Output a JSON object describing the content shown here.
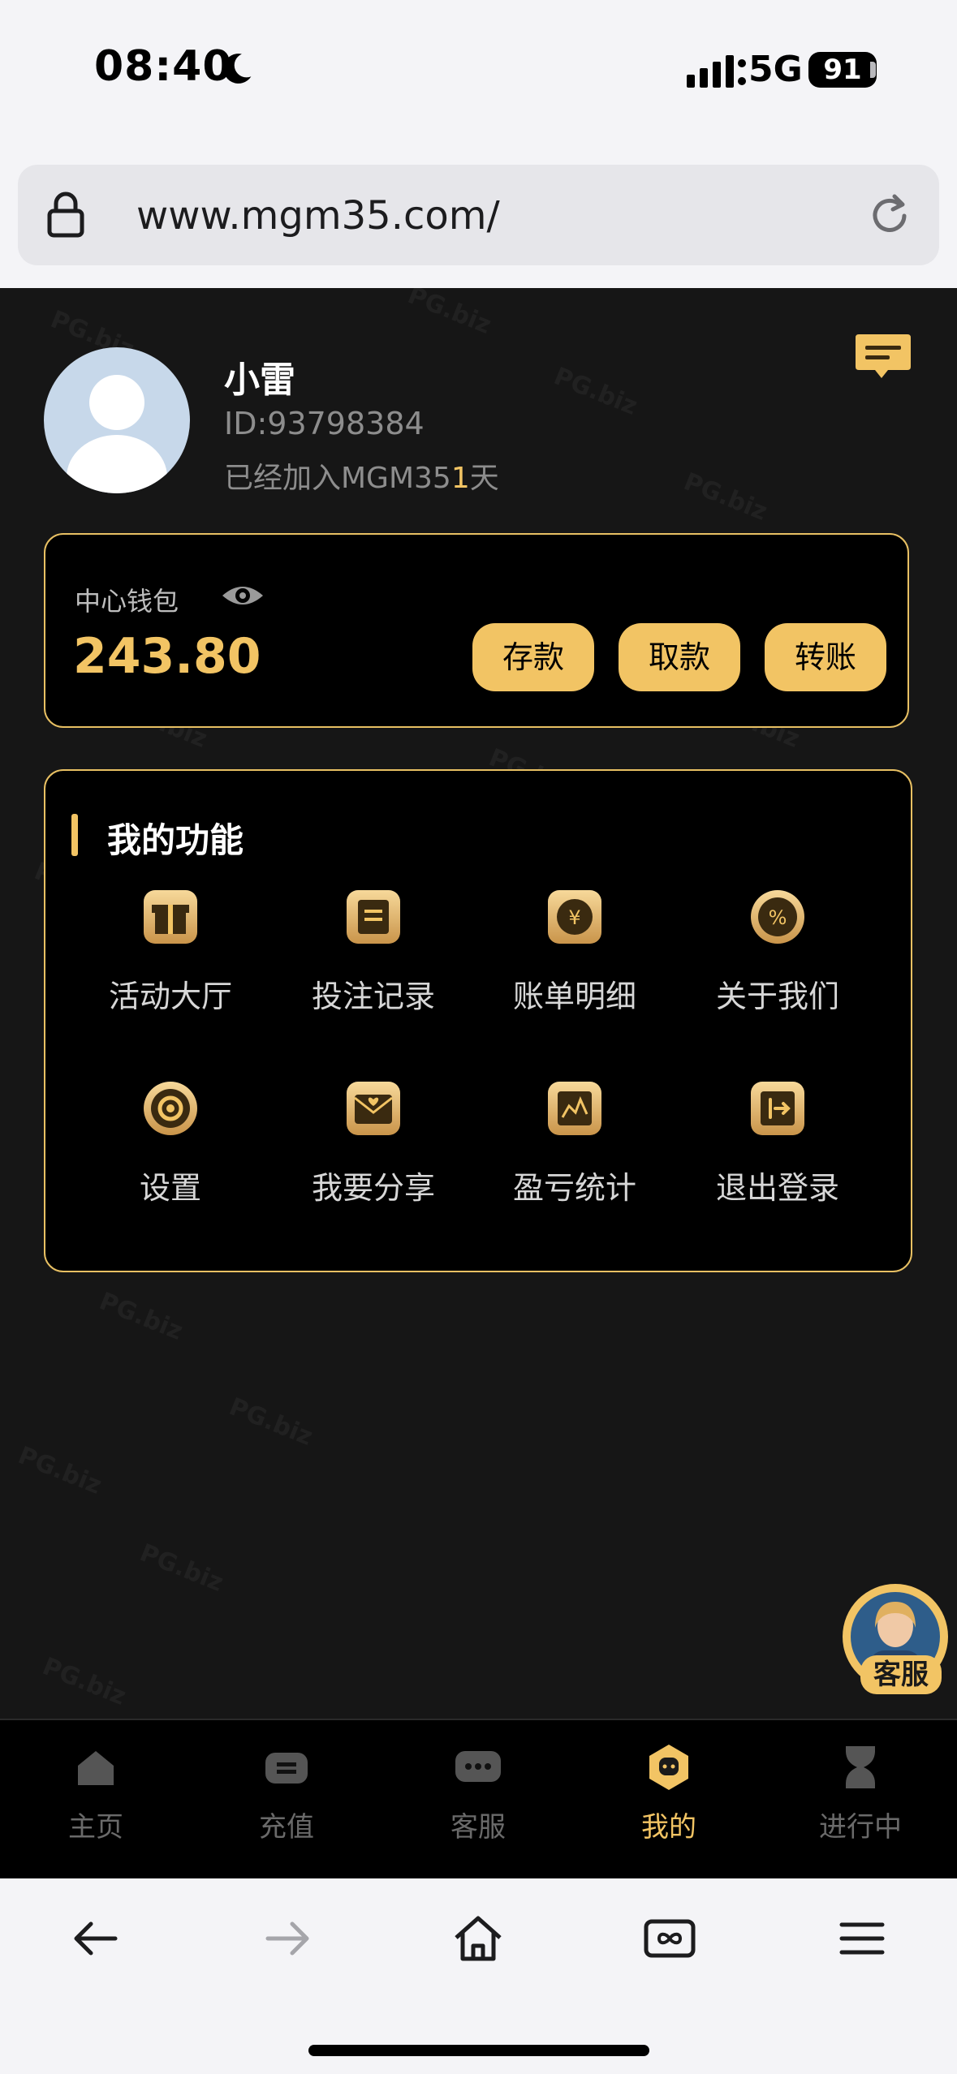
{
  "status_bar": {
    "time": "08:40",
    "network": "5G",
    "battery": "91"
  },
  "browser": {
    "url": "www.mgm35.com/"
  },
  "profile": {
    "name": "小雷",
    "id": "ID:93798384",
    "joined_prefix": "已经加入MGM35",
    "joined_days": "1",
    "joined_suffix": "天"
  },
  "wallet": {
    "label": "中心钱包",
    "balance": "243.80",
    "buttons": {
      "deposit": "存款",
      "withdraw": "取款",
      "transfer": "转账"
    }
  },
  "functions": {
    "title": "我的功能",
    "items": [
      {
        "label": "活动大厅",
        "icon": "gift-icon"
      },
      {
        "label": "投注记录",
        "icon": "record-icon"
      },
      {
        "label": "账单明细",
        "icon": "yen-icon"
      },
      {
        "label": "关于我们",
        "icon": "percent-icon"
      },
      {
        "label": "设置",
        "icon": "gear-icon"
      },
      {
        "label": "我要分享",
        "icon": "share-icon"
      },
      {
        "label": "盈亏统计",
        "icon": "chart-icon"
      },
      {
        "label": "退出登录",
        "icon": "logout-icon"
      }
    ]
  },
  "floating_service": {
    "label": "客服"
  },
  "tabs": [
    {
      "label": "主页",
      "icon": "home-icon"
    },
    {
      "label": "充值",
      "icon": "wallet-icon"
    },
    {
      "label": "客服",
      "icon": "chat-icon"
    },
    {
      "label": "我的",
      "icon": "profile-icon",
      "active": true
    },
    {
      "label": "进行中",
      "icon": "hourglass-icon"
    }
  ],
  "colors": {
    "accent": "#f2c464",
    "background": "#161616"
  }
}
